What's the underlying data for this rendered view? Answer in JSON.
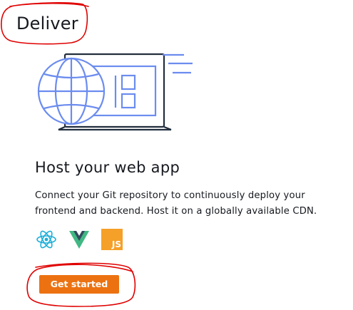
{
  "section": {
    "heading": "Deliver"
  },
  "card": {
    "title": "Host your web app",
    "description": "Connect your Git repository to continuously deploy your frontend and backend. Host it on a globally available CDN.",
    "frameworks": [
      {
        "icon": "react-icon",
        "color": "#1aaed9"
      },
      {
        "icon": "vue-icon",
        "color": "#41b883",
        "dark": "#34495e"
      },
      {
        "icon": "javascript-icon",
        "label": "JS",
        "color": "#f5a028"
      }
    ],
    "cta_label": "Get started"
  },
  "colors": {
    "illustration_blue": "#6b8cef",
    "illustration_dark": "#232f3e",
    "button_orange": "#ec7211",
    "annotation_red": "#e00000"
  }
}
